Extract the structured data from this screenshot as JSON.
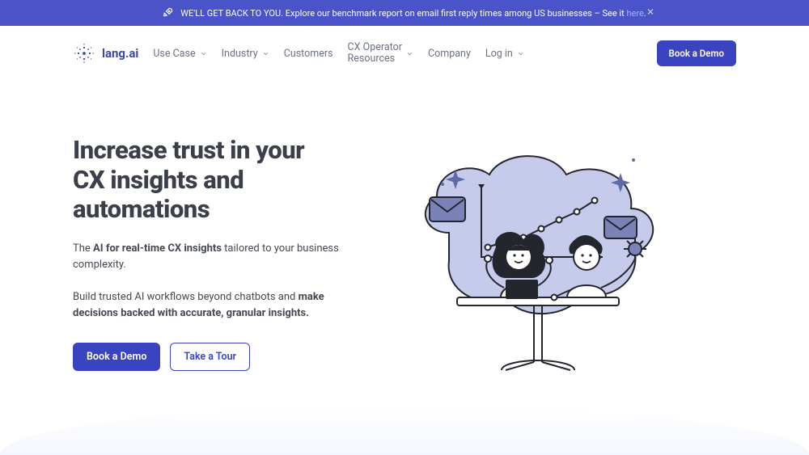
{
  "banner": {
    "text_prefix": "WE'LL GET BACK TO YOU. Explore our benchmark report on email first reply times among US businesses – See it ",
    "link_text": "here",
    "dot": "."
  },
  "logo": {
    "text": "lang.ai"
  },
  "nav": {
    "use_case": "Use Case",
    "industry": "Industry",
    "customers": "Customers",
    "cx_operator_line1": "CX Operator",
    "cx_operator_line2": "Resources",
    "company": "Company",
    "login": "Log in"
  },
  "header_cta": "Book a Demo",
  "hero": {
    "title": "Increase trust in your CX insights and automations",
    "p1_prefix": "The ",
    "p1_bold": "AI for real-time CX insights",
    "p1_suffix": " tailored to your business complexity.",
    "p2_prefix": "Build trusted AI workflows beyond chatbots and ",
    "p2_bold": "make decisions backed with accurate, granular insights.",
    "cta_primary": "Book a Demo",
    "cta_secondary": "Take a Tour"
  },
  "colors": {
    "brand": "#3a43c0",
    "banner": "#4a53c7",
    "text": "#3a3f4a",
    "nav": "#6b7280",
    "lilac": "#aeb5d8",
    "dark": "#24262d"
  }
}
